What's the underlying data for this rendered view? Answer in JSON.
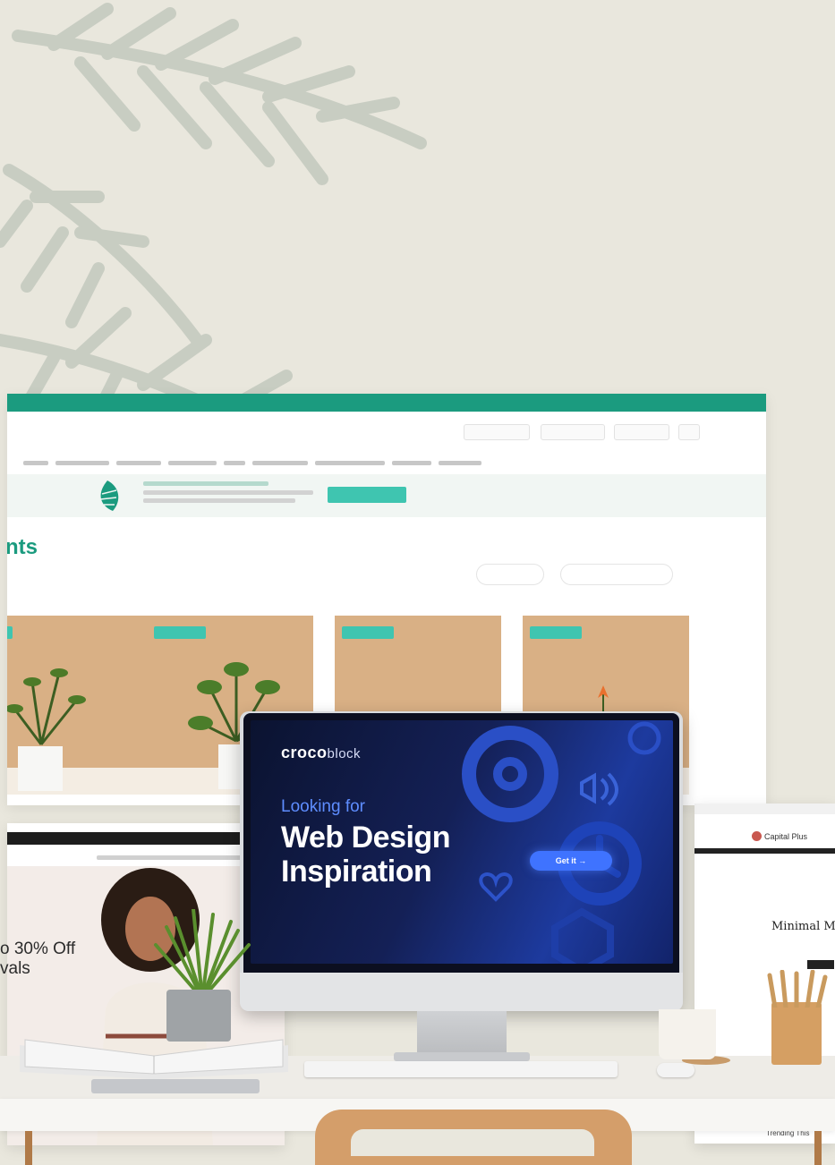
{
  "back_site": {
    "heading_fragment": "nts",
    "accent_color": "#1b9b7f"
  },
  "monitor_screen": {
    "brand_bold": "croco",
    "brand_light": "block",
    "eyebrow": "Looking for",
    "title_line1": "Web Design",
    "title_line2": "Inspiration",
    "button_label": "Get it",
    "button_arrow": "→",
    "icons": [
      "at-sign-icon",
      "speaker-icon",
      "clock-icon",
      "heart-icon",
      "cube-icon"
    ]
  },
  "left_site": {
    "promo_line1": "o 30% Off",
    "promo_line2": "vals"
  },
  "right_site": {
    "logo": "Capital Plus",
    "title": "Minimal Me",
    "footer": "Trending This"
  }
}
